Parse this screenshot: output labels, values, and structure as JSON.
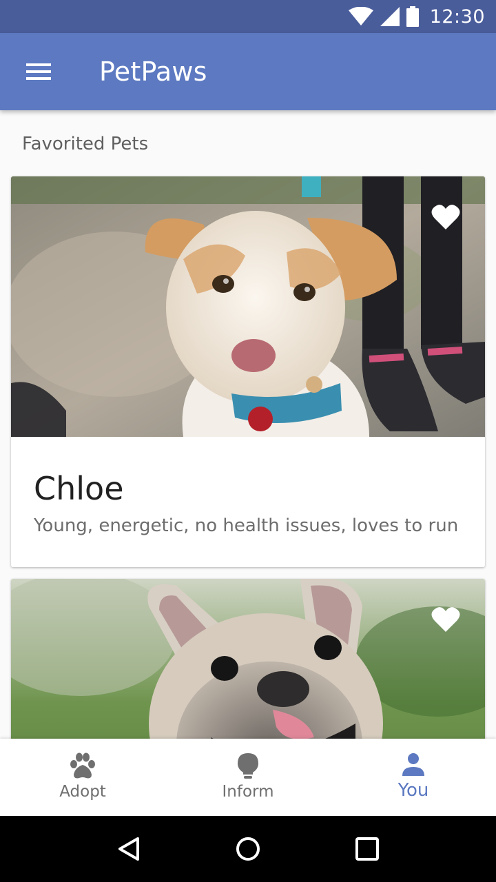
{
  "status_bar": {
    "time": "12:30",
    "icons": [
      "wifi-icon",
      "cell-signal-icon",
      "battery-icon"
    ]
  },
  "app_bar": {
    "title": "PetPaws",
    "menu_icon": "hamburger-menu-icon"
  },
  "main": {
    "section_title": "Favorited Pets",
    "cards": [
      {
        "name": "Chloe",
        "description": "Young, energetic, no health issues, loves to run",
        "image": "white-and-tan-dog-photo",
        "favorited": true
      },
      {
        "name": "",
        "description": "",
        "image": "french-bulldog-photo",
        "favorited": true
      }
    ]
  },
  "bottom_nav": {
    "items": [
      {
        "label": "Adopt",
        "icon": "paw-icon",
        "active": false
      },
      {
        "label": "Inform",
        "icon": "lightbulb-icon",
        "active": false
      },
      {
        "label": "You",
        "icon": "person-icon",
        "active": true
      }
    ]
  },
  "system_nav": {
    "buttons": [
      "back-icon",
      "home-icon",
      "recents-icon"
    ]
  },
  "colors": {
    "status_bar": "#4a5d9b",
    "app_bar": "#5c79c1",
    "accent": "#5c79c1",
    "background": "#fafafa",
    "inactive": "#6f6f6f"
  }
}
